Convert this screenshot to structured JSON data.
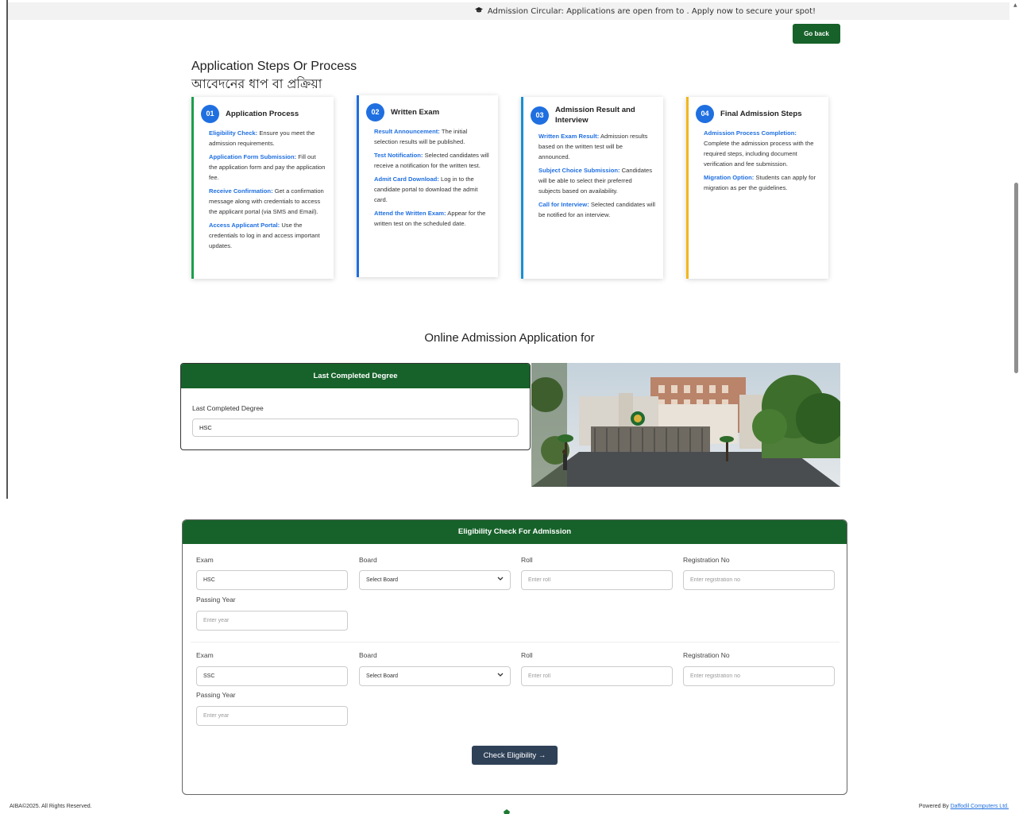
{
  "notice": {
    "text": "Admission Circular: Applications are open from to . Apply now to secure your spot!"
  },
  "header": {
    "go_back_label": "Go back"
  },
  "steps": {
    "title": "Application Steps Or Process",
    "title_bn": "আবেদনের ধাপ বা প্রক্রিয়া",
    "cards": [
      {
        "num": "01",
        "title": "Application Process",
        "items": [
          {
            "label": "Eligibility Check:",
            "text": "Ensure you meet the admission requirements."
          },
          {
            "label": "Application Form Submission:",
            "text": "Fill out the application form and pay the application fee."
          },
          {
            "label": "Receive Confirmation:",
            "text": "Get a confirmation message along with credentials to access the applicant portal (via SMS and Email)."
          },
          {
            "label": "Access Applicant Portal:",
            "text": "Use the credentials to log in and access important updates."
          }
        ]
      },
      {
        "num": "02",
        "title": "Written Exam",
        "items": [
          {
            "label": "Result Announcement:",
            "text": "The initial selection results will be published."
          },
          {
            "label": "Test Notification:",
            "text": "Selected candidates will receive a notification for the written test."
          },
          {
            "label": "Admit Card Download:",
            "text": "Log in to the candidate portal to download the admit card."
          },
          {
            "label": "Attend the Written Exam:",
            "text": "Appear for the written test on the scheduled date."
          }
        ]
      },
      {
        "num": "03",
        "title": "Admission Result and Interview",
        "items": [
          {
            "label": "Written Exam Result:",
            "text": "Admission results based on the written test will be announced."
          },
          {
            "label": "Subject Choice Submission:",
            "text": "Candidates will be able to select their preferred subjects based on availability."
          },
          {
            "label": "Call for Interview:",
            "text": "Selected candidates will be notified for an interview."
          }
        ]
      },
      {
        "num": "04",
        "title": "Final Admission Steps",
        "items": [
          {
            "label": "Admission Process Completion:",
            "text": "Complete the admission process with the required steps, including document verification and fee submission."
          },
          {
            "label": "Migration Option:",
            "text": "Students can apply for migration as per the guidelines."
          }
        ]
      }
    ]
  },
  "online_application": {
    "title": "Online Admission Application for"
  },
  "degree_panel": {
    "header": "Last Completed Degree",
    "label": "Last Completed Degree",
    "value": "HSC"
  },
  "eligibility": {
    "header": "Eligibility Check For Admission",
    "labels": {
      "exam": "Exam",
      "board": "Board",
      "roll": "Roll",
      "registration": "Registration No",
      "passing_year": "Passing Year"
    },
    "placeholders": {
      "roll": "Enter roll",
      "registration": "Enter registration no",
      "year": "Enter year"
    },
    "board_default": "Select Board",
    "rows": [
      {
        "exam": "HSC"
      },
      {
        "exam": "SSC"
      }
    ],
    "button_label": "Check Eligibility →"
  },
  "footer": {
    "copyright": "AIBA©2025. All Rights Reserved.",
    "powered_prefix": "Powered By",
    "powered_link": "Daffodil Computers Ltd."
  },
  "colors": {
    "brand_green": "#17622a",
    "accent_blue": "#1f6fe0",
    "button_navy": "#2f4157"
  }
}
